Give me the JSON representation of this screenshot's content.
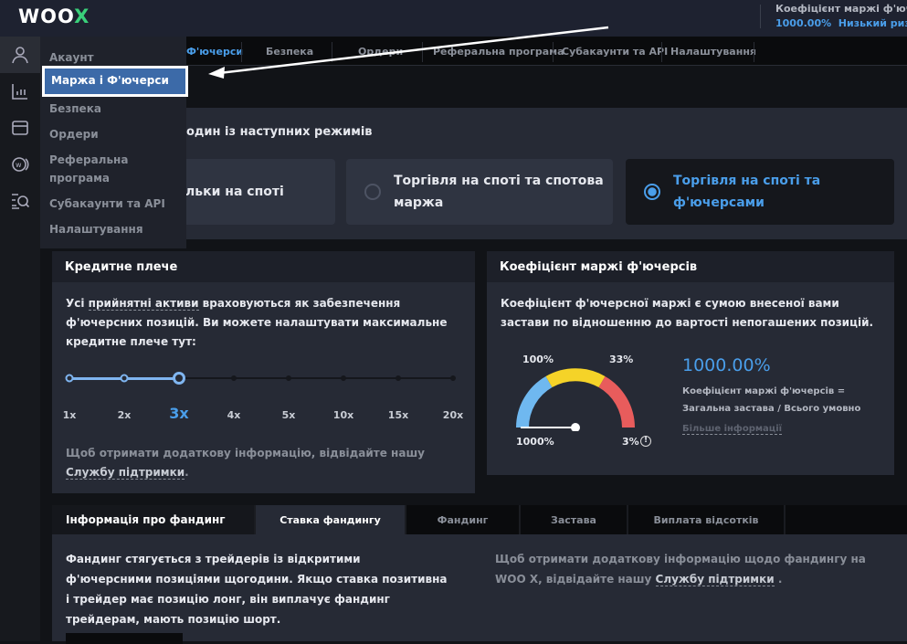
{
  "header": {
    "logo": "WOOX",
    "margin_label": "Коефіцієнт маржі ф'ючерсів",
    "margin_value": "1000.00%",
    "risk": "Низький ризик"
  },
  "sidebar_icons": [
    "user-icon",
    "chart-icon",
    "wallet-icon",
    "woo-token-icon",
    "search-list-icon"
  ],
  "tabs": [
    "Ф'ючерси",
    "Безпека",
    "Ордери",
    "Реферальна програма",
    "Субакаунти та API",
    "Налаштування"
  ],
  "dropdown": {
    "items": [
      "Акаунт",
      "Маржа і Ф'ючерси",
      "Безпека",
      "Ордери",
      "Реферальна програма",
      "Субакаунти та API",
      "Налаштування"
    ],
    "active": "Маржа і Ф'ючерси"
  },
  "modes": {
    "title": "один із наступних режимів",
    "options": [
      {
        "label": "льки на споті",
        "selected": false
      },
      {
        "label": "Торгівля на споті та спотова маржа",
        "selected": false
      },
      {
        "label": "Торгівля на споті та ф'ючерсами",
        "selected": true
      }
    ]
  },
  "leverage": {
    "title": "Кредитне плече",
    "text_1": "Усі ",
    "link_assets": "прийнятні активи",
    "text_2": " враховуються як забезпечення ф'ючерсних позицій. Ви можете налаштувати максимальне кредитне плече тут:",
    "levels": [
      "1x",
      "2x",
      "3x",
      "4x",
      "5x",
      "10x",
      "15x",
      "20x"
    ],
    "selected": "3x",
    "help_1": "Щоб отримати додаткову інформацію, відвідайте нашу ",
    "help_link": "Службу підтримки",
    "help_2": "."
  },
  "margin": {
    "title": "Коефіцієнт маржі ф'ючерсів",
    "desc": "Коефіцієнт ф'ючерсної маржі є сумою внесеної вами застави по відношенню до вартості непогашених позицій.",
    "gauge_labels": {
      "left": "1000%",
      "top_left": "100%",
      "top_right": "33%",
      "right": "3%"
    },
    "value": "1000.00%",
    "formula_1": "Коефіцієнт маржі ф'ючерсів =",
    "formula_2": "Загальна застава / Всього умовно",
    "more": "Більше інформації",
    "colors": {
      "safe": "#6fb8f0",
      "warn": "#f5d328",
      "danger": "#e85c5c"
    }
  },
  "funding": {
    "title": "Інформація про фандинг",
    "tabs": [
      "Ставка фандингу",
      "Фандинг",
      "Застава",
      "Виплата відсотків"
    ],
    "active_tab": "Ставка фандингу",
    "text": "Фандинг стягується з трейдерів із відкритими ф'ючерсними позиціями щогодини. Якщо ставка позитивна і трейдер має позицію лонг, він виплачує фандинг трейдерам, мають позицію шорт.",
    "help_1": "Щоб отримати додаткову інформацію щодо фандингу на WOO X, відвідайте нашу ",
    "help_link": "Службу підтримки",
    "help_2": " ."
  },
  "accent": "#4a9eea"
}
